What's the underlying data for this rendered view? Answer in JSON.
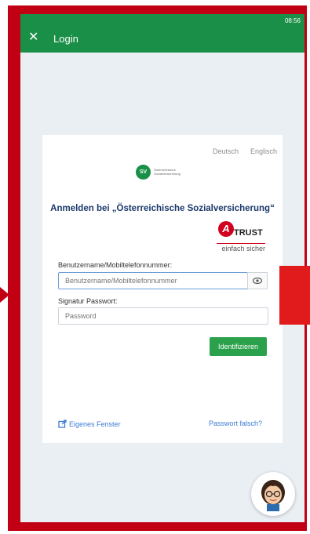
{
  "status_bar": {
    "time": "08:56"
  },
  "app_bar": {
    "close_glyph": "✕",
    "title": "Login"
  },
  "card": {
    "languages": [
      "Deutsch",
      "Englisch"
    ],
    "logo": {
      "mark_text": "SV",
      "line1": "Österreichische",
      "line2": "Sozialversicherung"
    },
    "heading": "Anmelden bei „Österreichische Sozialversicherung“",
    "trust_logo": {
      "letter": "A",
      "word": "TRUST",
      "tagline": "einfach sicher"
    },
    "username": {
      "label": "Benutzername/Mobiltelefonnummer:",
      "placeholder": "Benutzername/Mobiltelefonnummer",
      "value": ""
    },
    "password": {
      "label": "Signatur Passwort:",
      "placeholder": "Password",
      "value": ""
    },
    "submit_label": "Identifizieren",
    "own_window_label": "Eigenes Fenster",
    "forgot_label": "Passwort falsch?"
  },
  "colors": {
    "frame": "#c20014",
    "app_bar": "#1a8f47",
    "button": "#2aa14a",
    "heading": "#1b3a6b",
    "link": "#3e7bd6",
    "background": "#eaeff4"
  },
  "icons": [
    "close-icon",
    "eye-icon",
    "external-window-icon",
    "assistant-avatar-icon"
  ]
}
